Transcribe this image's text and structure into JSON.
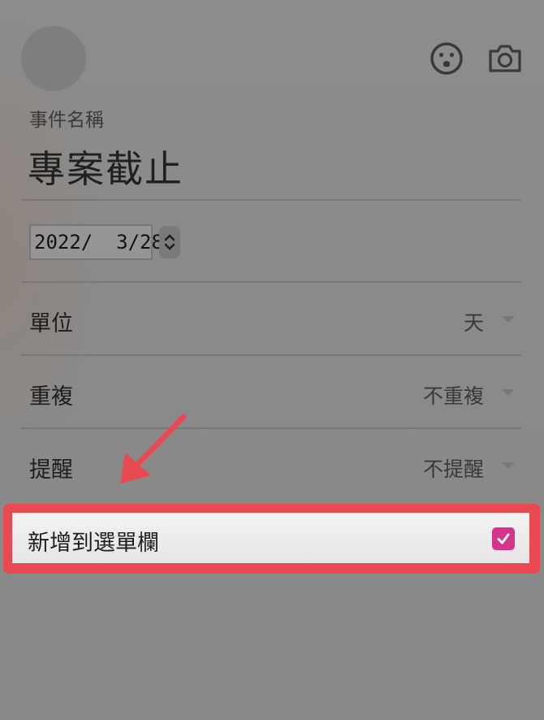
{
  "header": {
    "avatar": "avatar-placeholder",
    "emoji_icon": "smiley-face-icon",
    "camera_icon": "camera-icon"
  },
  "event": {
    "name_label": "事件名稱",
    "name_value": "專案截止",
    "date_value": "2022/  3/28"
  },
  "settings": {
    "unit": {
      "label": "單位",
      "value": "天"
    },
    "repeat": {
      "label": "重複",
      "value": "不重複"
    },
    "reminder": {
      "label": "提醒",
      "value": "不提醒"
    }
  },
  "menu_bar": {
    "label": "新增到選單欄",
    "checked": true
  },
  "colors": {
    "highlight": "#e94a52",
    "checkbox": "#d6338a"
  }
}
